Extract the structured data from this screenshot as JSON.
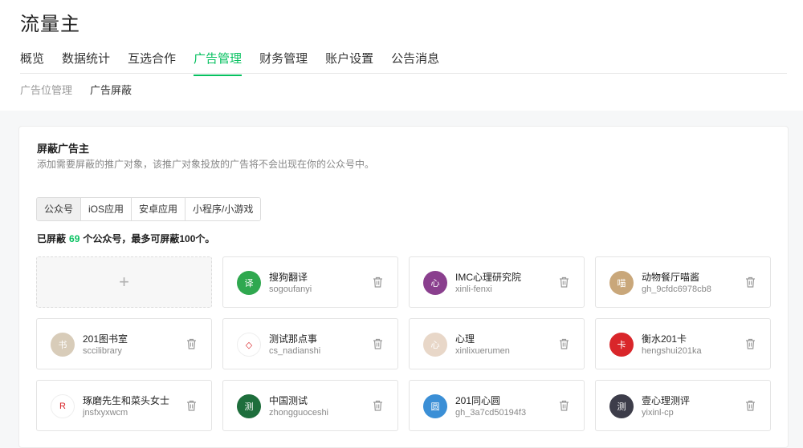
{
  "app": {
    "title": "流量主"
  },
  "nav": {
    "tabs": [
      {
        "label": "概览",
        "active": false
      },
      {
        "label": "数据统计",
        "active": false
      },
      {
        "label": "互选合作",
        "active": false
      },
      {
        "label": "广告管理",
        "active": true
      },
      {
        "label": "财务管理",
        "active": false
      },
      {
        "label": "账户设置",
        "active": false
      },
      {
        "label": "公告消息",
        "active": false
      }
    ]
  },
  "subnav": {
    "items": [
      {
        "label": "广告位管理",
        "active": false
      },
      {
        "label": "广告屏蔽",
        "active": true
      }
    ]
  },
  "block": {
    "title": "屏蔽广告主",
    "description": "添加需要屏蔽的推广对象，该推广对象投放的广告将不会出现在你的公众号中。",
    "segments": [
      {
        "label": "公众号",
        "active": true
      },
      {
        "label": "iOS应用",
        "active": false
      },
      {
        "label": "安卓应用",
        "active": false
      },
      {
        "label": "小程序/小游戏",
        "active": false
      }
    ],
    "count_prefix": "已屏蔽",
    "count_value": "69",
    "count_suffix": "个公众号，最多可屏蔽100个。",
    "add_symbol": "+"
  },
  "accounts": [
    {
      "name": "搜狗翻译",
      "id": "sogoufanyi",
      "avatar_color": "#2fa84f",
      "avatar_text": "译"
    },
    {
      "name": "IMC心理研究院",
      "id": "xinli-fenxi",
      "avatar_color": "#8a3f8e",
      "avatar_text": "心"
    },
    {
      "name": "动物餐厅喵酱",
      "id": "gh_9cfdc6978cb8",
      "avatar_color": "#c9a77a",
      "avatar_text": "喵"
    },
    {
      "name": "201图书室",
      "id": "sccilibrary",
      "avatar_color": "#d8ccb9",
      "avatar_text": "书"
    },
    {
      "name": "测试那点事",
      "id": "cs_nadianshi",
      "avatar_color": "#ffffff",
      "avatar_text": "◇"
    },
    {
      "name": "心理",
      "id": "xinlixuerumen",
      "avatar_color": "#e8d7c8",
      "avatar_text": "心"
    },
    {
      "name": "衡水201卡",
      "id": "hengshui201ka",
      "avatar_color": "#d9262a",
      "avatar_text": "卡"
    },
    {
      "name": "琢磨先生和菜头女士",
      "id": "jnsfxyxwcm",
      "avatar_color": "#ffffff",
      "avatar_text": "R"
    },
    {
      "name": "中国测试",
      "id": "zhongguoceshi",
      "avatar_color": "#1e6e3c",
      "avatar_text": "测"
    },
    {
      "name": "201同心圆",
      "id": "gh_3a7cd50194f3",
      "avatar_color": "#3b8fd6",
      "avatar_text": "圆"
    },
    {
      "name": "壹心理测评",
      "id": "yixinl-cp",
      "avatar_color": "#3d3d4a",
      "avatar_text": "测"
    }
  ],
  "colors": {
    "accent": "#07c160"
  }
}
